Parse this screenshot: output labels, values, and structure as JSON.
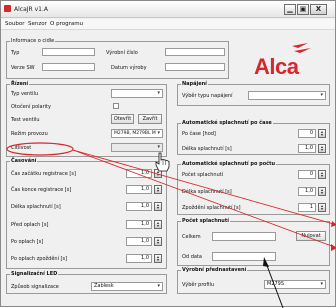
{
  "window": {
    "title": "AlcaJR v1.A",
    "min": "▁",
    "max": "▣",
    "close": "X"
  },
  "menu": [
    "Soubor",
    "Senzor",
    "O programu"
  ],
  "info": {
    "title": "Informace o cidle",
    "typ_label": "Typ",
    "verze_label": "Verze SW",
    "vyrobni_label": "Výrobní číslo",
    "datum_label": "Datum výroby"
  },
  "logo": "Alca",
  "rizeni": {
    "title": "Řízení",
    "typ_ventilu": "Typ ventilu",
    "otoceni": "Otočení polarity",
    "test": "Test ventilu",
    "otevrit": "Otevřít",
    "zavrit": "Zavřít",
    "rezim": "Režim provozu",
    "rezim_value": "M279B, M279BL M",
    "citlivost": "Citlivost"
  },
  "casovani": {
    "title": "Časování",
    "rows": [
      {
        "label": "Čas začátku registrace [s]",
        "value": "1,0"
      },
      {
        "label": "Čas konce registrace [s]",
        "value": "1,0"
      },
      {
        "label": "Délka splachnutí [s]",
        "value": "1,0"
      },
      {
        "label": "Před oplach [s]",
        "value": "1,0"
      },
      {
        "label": "Po oplach [s]",
        "value": "1,0"
      },
      {
        "label": "Po oplach zpoždění [s]",
        "value": "1,0"
      }
    ]
  },
  "signal": {
    "title": "Signalizační LED",
    "label": "Způsob signalizace",
    "value": "Zablesk"
  },
  "napajeni": {
    "title": "Napájení",
    "label": "Výběr typu napájení"
  },
  "auto_cas": {
    "title": "Automatické splachnutí po čase",
    "po_case": "Po čase [hod]",
    "po_case_value": "0",
    "delka": "Délka splachnutí [s]",
    "delka_value": "1,0"
  },
  "auto_poc": {
    "title": "Automatické splachnutí po počtu",
    "pocet": "Počet splachnutí",
    "pocet_value": "0",
    "delka": "Délka splachnutí [s]",
    "delka_value": "1,0",
    "zpozdeni": "Zpoždění splachnutí [s]",
    "zpozdeni_value": "1"
  },
  "pocet_spl": {
    "title": "Počet splachnutí",
    "celkem": "Celkem",
    "nulovat": "Nulovat",
    "od_data": "Od data"
  },
  "vyrobni": {
    "title": "Výrobní přednastavení",
    "label": "Výběr profilu",
    "value": "M279S"
  }
}
